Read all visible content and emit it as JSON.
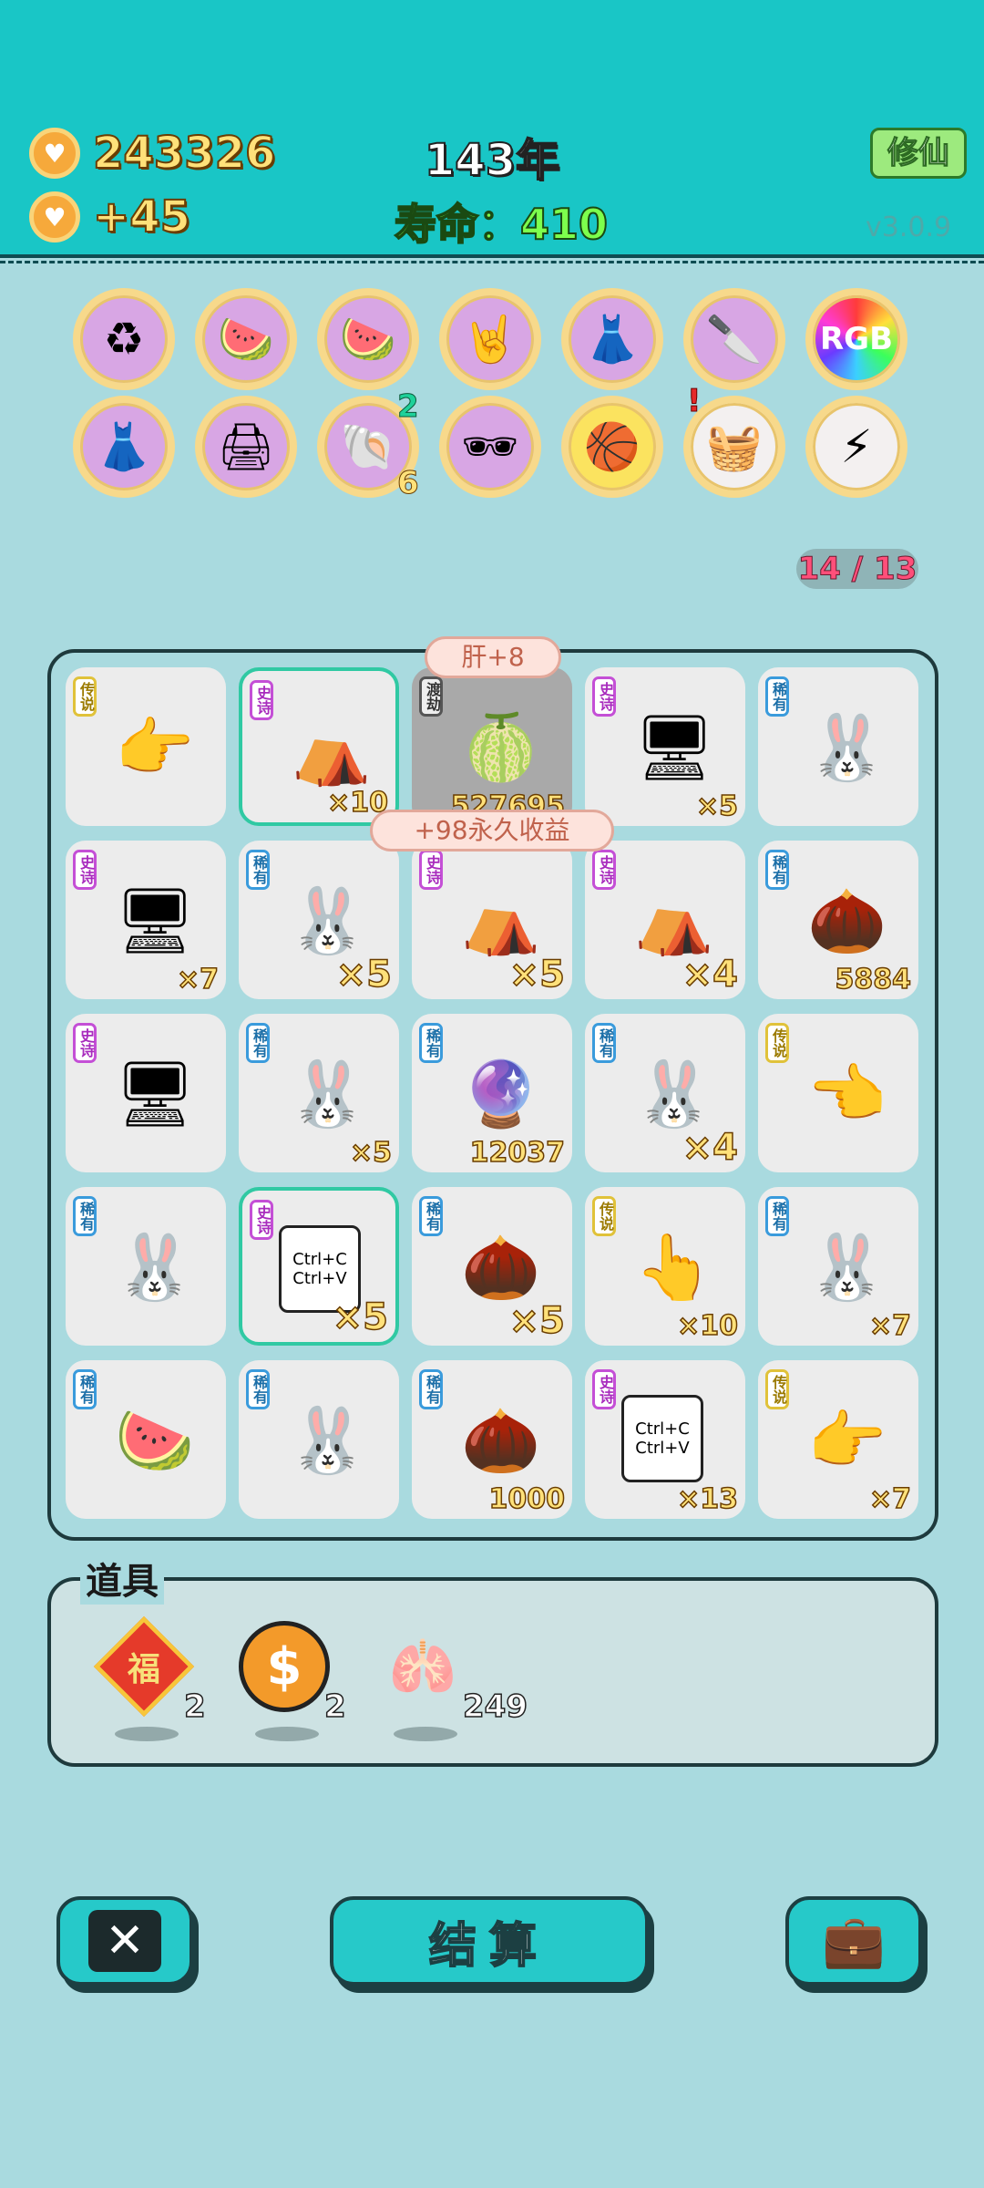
{
  "header": {
    "coins": "243326",
    "income": "+45",
    "year": "143年",
    "lifespan": "寿命：410",
    "xiuxian_label": "修仙",
    "version": "v3.0.9"
  },
  "relics": [
    {
      "name": "recycle-icon",
      "glyph": "♻",
      "style": "p"
    },
    {
      "name": "fruit-basket-v-icon",
      "glyph": "🍉",
      "style": "p"
    },
    {
      "name": "fruit-basket-v-icon-2",
      "glyph": "🍉",
      "style": "p"
    },
    {
      "name": "rock-hand-icon",
      "glyph": "🤘",
      "style": "p"
    },
    {
      "name": "skirt-icon",
      "glyph": "👗",
      "style": "p"
    },
    {
      "name": "cleaver-icon",
      "glyph": "🔪",
      "style": "p"
    },
    {
      "name": "rgb-icon",
      "glyph": "RGB",
      "style": "rgb"
    },
    {
      "name": "skirt-icon-2",
      "glyph": "👗",
      "style": "p"
    },
    {
      "name": "printer-icon",
      "glyph": "🖨",
      "style": "p"
    },
    {
      "name": "shell-icon",
      "glyph": "🐚",
      "style": "p",
      "badge_top": "2",
      "badge_bottom": "6"
    },
    {
      "name": "longan-sunglasses-icon",
      "glyph": "🕶",
      "style": "p"
    },
    {
      "name": "basketballs-icon",
      "glyph": "🏀",
      "style": "y"
    },
    {
      "name": "gift-basket-icon",
      "glyph": "🧺",
      "style": "w",
      "alert": "!"
    },
    {
      "name": "lightning-icon",
      "glyph": "⚡",
      "style": "w"
    }
  ],
  "counter": "14 / 13",
  "bubbles": {
    "top": "肝+8",
    "mid": "+98永久收益"
  },
  "board": [
    {
      "rarity": "传说",
      "rc": "r-yellow",
      "glyph": "👉",
      "count": "",
      "name": "finger-pointer"
    },
    {
      "rarity": "史诗",
      "rc": "r-purple",
      "glyph": "⛺",
      "count": "×10",
      "name": "tent",
      "sel": true
    },
    {
      "rarity": "渡劫",
      "rc": "r-grey",
      "glyph": "🍈",
      "count": "527695",
      "name": "longan-pair",
      "grey": true
    },
    {
      "rarity": "史诗",
      "rc": "r-purple",
      "glyph": "🖥",
      "count": "×5",
      "name": "rgb-fans"
    },
    {
      "rarity": "稀有",
      "rc": "r-blue",
      "glyph": "🐰",
      "count": "",
      "name": "bunny"
    },
    {
      "rarity": "史诗",
      "rc": "r-purple",
      "glyph": "🖥",
      "count": "×7",
      "name": "rgb-fans"
    },
    {
      "rarity": "稀有",
      "rc": "r-blue",
      "glyph": "🐰",
      "count": "×5",
      "name": "bunny",
      "big": true
    },
    {
      "rarity": "史诗",
      "rc": "r-purple",
      "glyph": "⛺",
      "count": "×5",
      "name": "tent",
      "big": true
    },
    {
      "rarity": "史诗",
      "rc": "r-purple",
      "glyph": "⛺",
      "count": "×4",
      "name": "tent",
      "big": true
    },
    {
      "rarity": "稀有",
      "rc": "r-blue",
      "glyph": "🌰",
      "count": "5884",
      "name": "longan"
    },
    {
      "rarity": "史诗",
      "rc": "r-purple",
      "glyph": "🖥",
      "count": "",
      "name": "rgb-fans"
    },
    {
      "rarity": "稀有",
      "rc": "r-blue",
      "glyph": "🐰",
      "count": "×5",
      "name": "bunny"
    },
    {
      "rarity": "稀有",
      "rc": "r-blue",
      "glyph": "🔮",
      "count": "12037",
      "name": "gacha-ball"
    },
    {
      "rarity": "稀有",
      "rc": "r-blue",
      "glyph": "🐰",
      "count": "×4",
      "name": "bunny",
      "big": true
    },
    {
      "rarity": "传说",
      "rc": "r-yellow",
      "glyph": "👈",
      "count": "",
      "name": "finger-pointer"
    },
    {
      "rarity": "稀有",
      "rc": "r-blue",
      "glyph": "🐰",
      "count": "",
      "name": "bunny"
    },
    {
      "rarity": "史诗",
      "rc": "r-purple",
      "glyph": "📋",
      "count": "×5",
      "name": "copy-paste",
      "sel": true,
      "big": true
    },
    {
      "rarity": "稀有",
      "rc": "r-blue",
      "glyph": "🌰",
      "count": "×5",
      "name": "longan",
      "big": true
    },
    {
      "rarity": "传说",
      "rc": "r-yellow",
      "glyph": "👆",
      "count": "×10",
      "name": "finger-pointer"
    },
    {
      "rarity": "稀有",
      "rc": "r-blue",
      "glyph": "🐰",
      "count": "×7",
      "name": "bunny"
    },
    {
      "rarity": "稀有",
      "rc": "r-blue",
      "glyph": "🍉",
      "count": "",
      "name": "watermelon"
    },
    {
      "rarity": "稀有",
      "rc": "r-blue",
      "glyph": "🐰",
      "count": "",
      "name": "bunny"
    },
    {
      "rarity": "稀有",
      "rc": "r-blue",
      "glyph": "🌰",
      "count": "1000",
      "name": "longan"
    },
    {
      "rarity": "史诗",
      "rc": "r-purple",
      "glyph": "📋",
      "count": "×13",
      "name": "copy-paste"
    },
    {
      "rarity": "传说",
      "rc": "r-yellow",
      "glyph": "👉",
      "count": "×7",
      "name": "finger-pointer"
    }
  ],
  "cell_texts": {
    "ctrl_c": "Ctrl+C",
    "ctrl_v": "Ctrl+V"
  },
  "props": {
    "title": "道具",
    "items": [
      {
        "name": "fu-charm-icon",
        "glyph": "福",
        "count": "2"
      },
      {
        "name": "coin-icon",
        "glyph": "$",
        "count": "2"
      },
      {
        "name": "liver-icon",
        "glyph": "🫁",
        "count": "249"
      }
    ]
  },
  "buttons": {
    "close_label": "✕",
    "settle_label": "结算",
    "bag_label": "💼"
  }
}
